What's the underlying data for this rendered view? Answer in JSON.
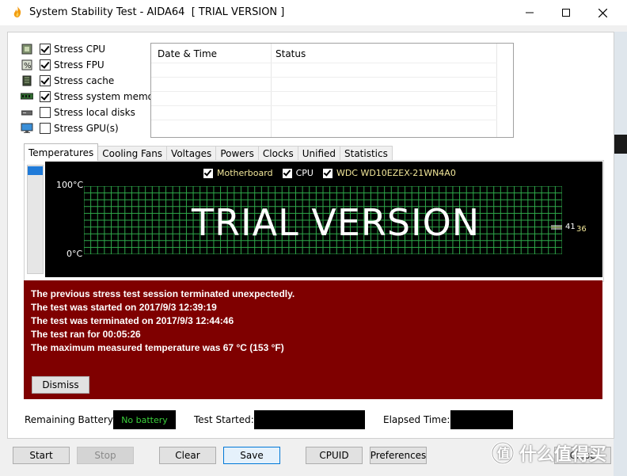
{
  "window": {
    "title": "System Stability Test - AIDA64  [ TRIAL VERSION ]"
  },
  "stress_options": [
    {
      "label": "Stress CPU",
      "checked": true,
      "icon": "cpu-chip-icon"
    },
    {
      "label": "Stress FPU",
      "checked": true,
      "icon": "fpu-percent-icon"
    },
    {
      "label": "Stress cache",
      "checked": true,
      "icon": "cache-chip-icon"
    },
    {
      "label": "Stress system memory",
      "checked": true,
      "icon": "memory-module-icon"
    },
    {
      "label": "Stress local disks",
      "checked": false,
      "icon": "disk-drive-icon"
    },
    {
      "label": "Stress GPU(s)",
      "checked": false,
      "icon": "monitor-icon"
    }
  ],
  "log": {
    "col_datetime": "Date & Time",
    "col_status": "Status"
  },
  "tabs": [
    "Temperatures",
    "Cooling Fans",
    "Voltages",
    "Powers",
    "Clocks",
    "Unified",
    "Statistics"
  ],
  "active_tab": "Temperatures",
  "graph": {
    "legend": [
      {
        "label": "Motherboard",
        "color": "#f3e89a"
      },
      {
        "label": "CPU",
        "color": "#ffffff"
      },
      {
        "label": "WDC WD10EZEX-21WN4A0",
        "color": "#f3e89a"
      }
    ],
    "y_max_label": "100°C",
    "y_min_label": "0°C",
    "watermark": "TRIAL VERSION",
    "value_a": "41",
    "value_b": "36",
    "grid_color": "#2ea84a"
  },
  "error": {
    "lines": [
      "The previous stress test session terminated unexpectedly.",
      "The test was started on 2017/9/3 12:39:19",
      "The test was terminated on 2017/9/3 12:44:46",
      "The test ran for 00:05:26",
      "The maximum measured temperature was 67 °C  (153 °F)"
    ],
    "dismiss_label": "Dismiss",
    "background": "#7f0000"
  },
  "status": {
    "battery_label": "Remaining Battery:",
    "battery_value": "No battery",
    "started_label": "Test Started:",
    "started_value": "",
    "elapsed_label": "Elapsed Time:",
    "elapsed_value": ""
  },
  "buttons": {
    "start": "Start",
    "stop": "Stop",
    "clear": "Clear",
    "save": "Save",
    "cpuid": "CPUID",
    "preferences": "Preferences",
    "close": "Close"
  },
  "watermark_text": "什么值得买"
}
